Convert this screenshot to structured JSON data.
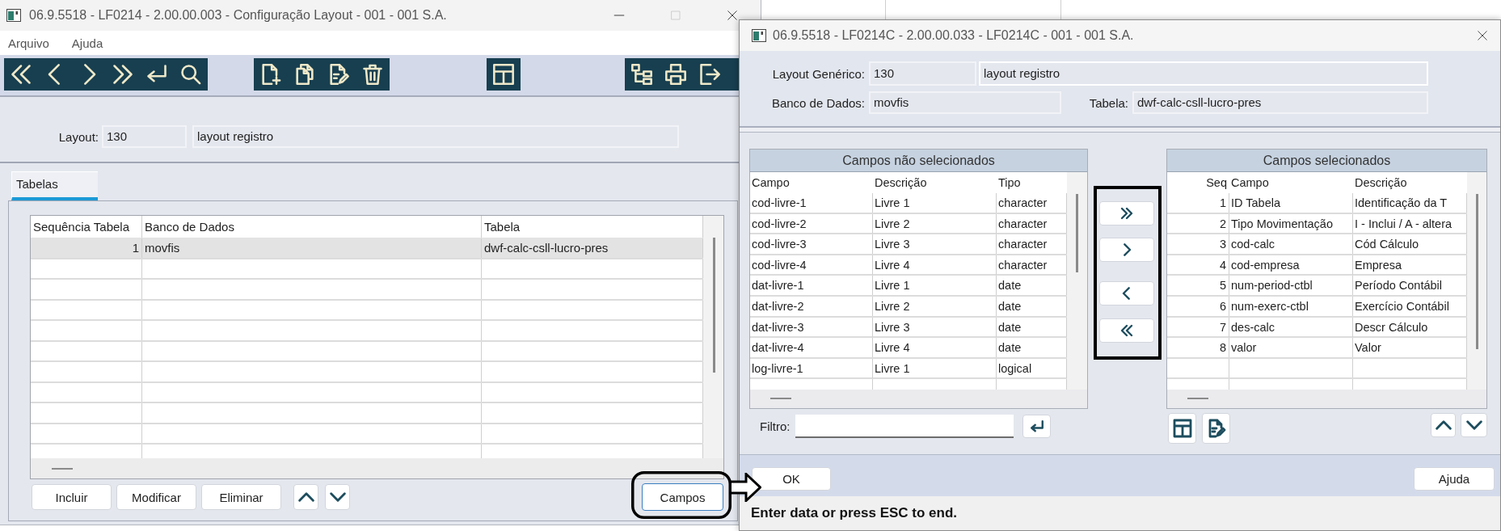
{
  "main_window": {
    "title": "06.9.5518 - LF0214 - 2.00.00.003 - Configuração Layout - 001 - 001 S.A.",
    "menu": [
      {
        "label": "Arquivo"
      },
      {
        "label": "Ajuda"
      }
    ],
    "layout": {
      "label": "Layout:",
      "code": "130",
      "description": "layout registro"
    },
    "tabs": [
      {
        "label": "Tabelas",
        "selected": true
      }
    ],
    "table": {
      "columns": [
        "Sequência Tabela",
        "Banco de Dados",
        "Tabela"
      ],
      "rows": [
        {
          "cells": [
            "1",
            "movfis",
            "dwf-calc-csll-lucro-pres"
          ],
          "selected": true
        }
      ]
    },
    "buttons": [
      {
        "label": "Incluir"
      },
      {
        "label": "Modificar"
      },
      {
        "label": "Eliminar"
      }
    ],
    "fields_button": {
      "label": "Campos"
    }
  },
  "dialog": {
    "title": "06.9.5518 - LF0214C - 2.00.00.033 - LF0214C - 001 - 001 S.A.",
    "layout": {
      "label": "Layout Genérico:",
      "code": "130",
      "description": "layout registro"
    },
    "database": {
      "label": "Banco de Dados:",
      "value": "movfis"
    },
    "table": {
      "label": "Tabela:",
      "value": "dwf-calc-csll-lucro-pres"
    },
    "unselected_fields": {
      "title": "Campos não selecionados",
      "columns": [
        "Campo",
        "Descrição",
        "Tipo"
      ],
      "rows": [
        {
          "cells": [
            "cod-livre-1",
            "Livre 1",
            "character"
          ],
          "selected": false
        },
        {
          "cells": [
            "cod-livre-2",
            "Livre 2",
            "character"
          ],
          "selected": false
        },
        {
          "cells": [
            "cod-livre-3",
            "Livre 3",
            "character"
          ],
          "selected": false
        },
        {
          "cells": [
            "cod-livre-4",
            "Livre 4",
            "character"
          ],
          "selected": false
        },
        {
          "cells": [
            "dat-livre-1",
            "Livre 1",
            "date"
          ],
          "selected": false
        },
        {
          "cells": [
            "dat-livre-2",
            "Livre 2",
            "date"
          ],
          "selected": false
        },
        {
          "cells": [
            "dat-livre-3",
            "Livre 3",
            "date"
          ],
          "selected": false
        },
        {
          "cells": [
            "dat-livre-4",
            "Livre 4",
            "date"
          ],
          "selected": false
        },
        {
          "cells": [
            "log-livre-1",
            "Livre 1",
            "logical"
          ],
          "selected": false
        }
      ]
    },
    "filter": {
      "label": "Filtro:"
    },
    "selected_fields": {
      "title": "Campos selecionados",
      "columns": [
        "Seq",
        "Campo",
        "Descrição"
      ],
      "rows": [
        {
          "cells": [
            "1",
            "ID Tabela",
            "Identificação da T"
          ],
          "selected": false
        },
        {
          "cells": [
            "2",
            "Tipo Movimentação",
            "I - Inclui / A - altera"
          ],
          "selected": false
        },
        {
          "cells": [
            "3",
            "cod-calc",
            "Cód Cálculo"
          ],
          "selected": false
        },
        {
          "cells": [
            "4",
            "cod-empresa",
            "Empresa"
          ],
          "selected": false
        },
        {
          "cells": [
            "5",
            "num-period-ctbl",
            "Período Contábil"
          ],
          "selected": false
        },
        {
          "cells": [
            "6",
            "num-exerc-ctbl",
            "Exercício Contábil"
          ],
          "selected": false
        },
        {
          "cells": [
            "7",
            "des-calc",
            "Descr Cálculo"
          ],
          "selected": false
        },
        {
          "cells": [
            "8",
            "valor",
            "Valor"
          ],
          "selected": false
        }
      ]
    },
    "buttons": [
      {
        "label": "OK"
      },
      {
        "label": "Ajuda"
      }
    ],
    "status_bar": {
      "text": "Enter data or press ESC to end."
    }
  }
}
